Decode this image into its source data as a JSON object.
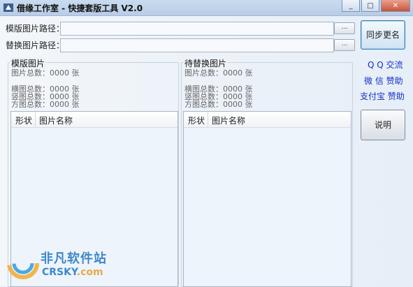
{
  "window": {
    "title": "借缘工作室 - 快捷套版工具 V2.0"
  },
  "paths": {
    "template_label": "模版图片路径：",
    "replace_label": "替换图片路径：",
    "template_value": "",
    "replace_value": "",
    "browse_label": "..."
  },
  "buttons": {
    "sync": "同步更名",
    "help": "说明"
  },
  "links": {
    "qq": "Q Q  交流",
    "wechat": "微  信  赞助",
    "alipay": "支付宝  赞助"
  },
  "left": {
    "title": "模版图片",
    "total": "图片总数：0000  张",
    "landscape": "横图总数：0000  张",
    "portrait": "竖图总数：0000  张",
    "square": "方图总数：0000  张",
    "col_shape": "形状",
    "col_name": "图片名称"
  },
  "right": {
    "title": "待替换图片",
    "total": "图片总数：0000  张",
    "landscape": "横图总数：0000  张",
    "portrait": "竖图总数：0000  张",
    "square": "方图总数：0000  张",
    "col_shape": "形状",
    "col_name": "图片名称"
  },
  "watermark": {
    "cn": "非凡软件站",
    "en": "CRSKY",
    "en_suffix": ".com"
  }
}
